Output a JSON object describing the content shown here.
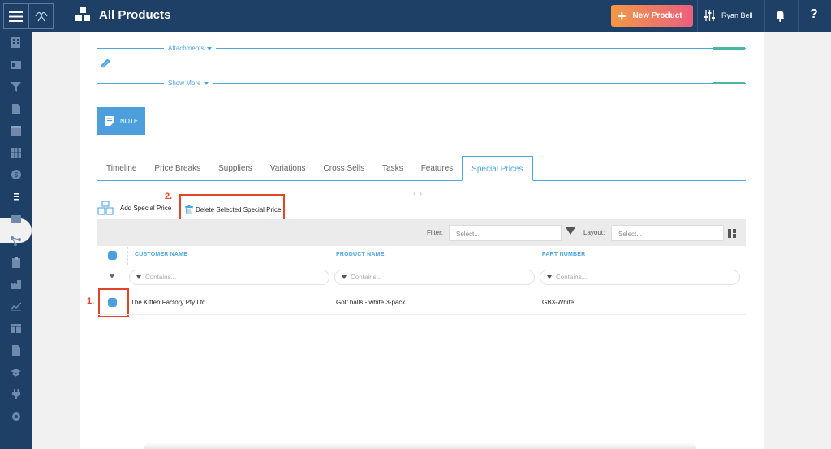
{
  "header": {
    "title": "All Products",
    "new_product_label": "New Product",
    "user_name": "Ryan Bell",
    "help_label": "?"
  },
  "sections": {
    "attachments_label": "Attachments",
    "show_more_label": "Show More"
  },
  "note_button_label": "NOTE",
  "tabs": [
    {
      "label": "Timeline"
    },
    {
      "label": "Price Breaks"
    },
    {
      "label": "Suppliers"
    },
    {
      "label": "Variations"
    },
    {
      "label": "Cross Sells"
    },
    {
      "label": "Tasks"
    },
    {
      "label": "Features"
    },
    {
      "label": "Special Prices",
      "active": true
    }
  ],
  "actions": {
    "add_label": "Add Special Price",
    "delete_label": "Delete Selected Special Price",
    "step1": "1.",
    "step2": "2."
  },
  "toolbar": {
    "filter_label": "Filter:",
    "filter_placeholder": "Select...",
    "layout_label": "Layout:",
    "layout_placeholder": "Select..."
  },
  "grid": {
    "columns": [
      "CUSTOMER NAME",
      "PRODUCT NAME",
      "PART NUMBER"
    ],
    "filter_placeholder": "Contains...",
    "rows": [
      {
        "customer": "The Kitten Factory Pty Ltd",
        "product": "Golf balls - white 3-pack",
        "part": "GB3-White"
      }
    ]
  },
  "colors": {
    "nav": "#1e3f66",
    "accent": "#4fa5e0",
    "highlight": "#e0452a",
    "new_product_gradient": [
      "#f29845",
      "#ec5f7d"
    ]
  }
}
